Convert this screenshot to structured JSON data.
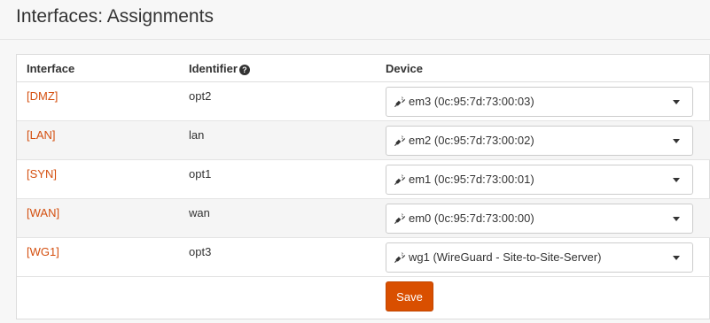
{
  "page": {
    "title": "Interfaces: Assignments"
  },
  "table": {
    "headers": {
      "interface": "Interface",
      "identifier": "Identifier",
      "device": "Device"
    },
    "rows": [
      {
        "interface": "[DMZ]",
        "identifier": "opt2",
        "device": "em3 (0c:95:7d:73:00:03)"
      },
      {
        "interface": "[LAN]",
        "identifier": "lan",
        "device": "em2 (0c:95:7d:73:00:02)"
      },
      {
        "interface": "[SYN]",
        "identifier": "opt1",
        "device": "em1 (0c:95:7d:73:00:01)"
      },
      {
        "interface": "[WAN]",
        "identifier": "wan",
        "device": "em0 (0c:95:7d:73:00:00)"
      },
      {
        "interface": "[WG1]",
        "identifier": "opt3",
        "device": "wg1 (WireGuard - Site-to-Site-Server)"
      }
    ]
  },
  "actions": {
    "save_label": "Save"
  },
  "icons": {
    "help": "question-circle-icon",
    "device": "plug-icon",
    "dropdown": "caret-down-icon"
  },
  "colors": {
    "accent": "#d94f00",
    "link": "#d44f0f"
  }
}
